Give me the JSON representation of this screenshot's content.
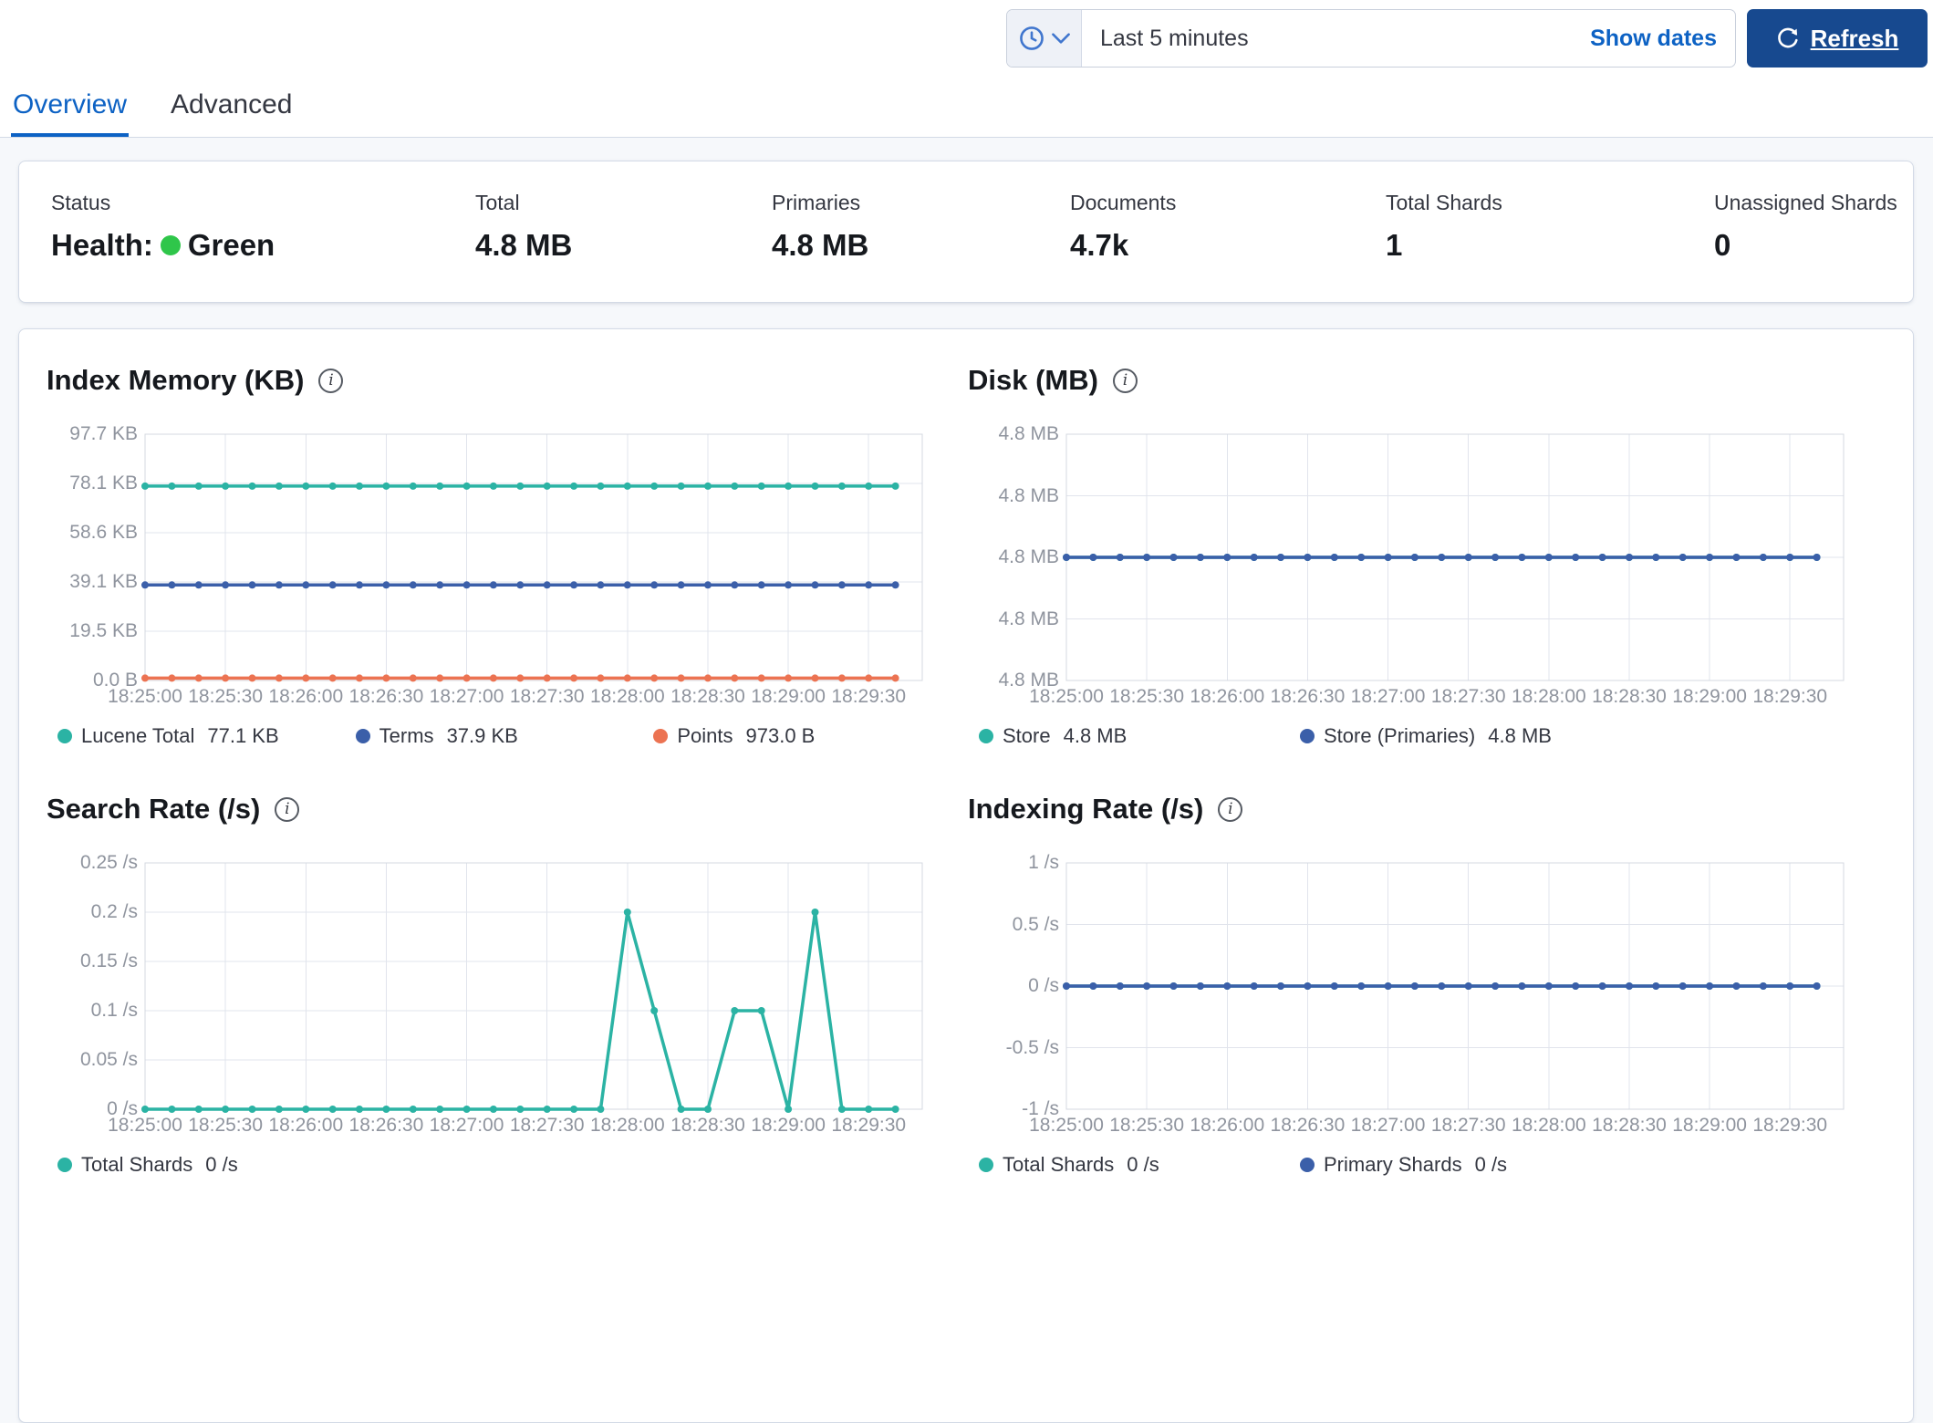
{
  "time_picker": {
    "selected": "Last 5 minutes",
    "show_dates_label": "Show dates",
    "refresh_label": "Refresh"
  },
  "tabs": [
    {
      "label": "Overview",
      "active": true
    },
    {
      "label": "Advanced",
      "active": false
    }
  ],
  "stats": [
    {
      "label": "Status",
      "value_prefix": "Health:",
      "value": "Green"
    },
    {
      "label": "Total",
      "value": "4.8 MB"
    },
    {
      "label": "Primaries",
      "value": "4.8 MB"
    },
    {
      "label": "Documents",
      "value": "4.7k"
    },
    {
      "label": "Total Shards",
      "value": "1"
    },
    {
      "label": "Unassigned Shards",
      "value": "0"
    }
  ],
  "colors": {
    "teal": "#2bb3a4",
    "blue": "#3b5fa9",
    "orange": "#ec7352",
    "health_green": "#2fc64a",
    "link_blue": "#0d62c4",
    "refresh_button_bg": "#17498f"
  },
  "chart_data": [
    {
      "type": "line",
      "title": "Index Memory (KB)",
      "y_ticks": [
        "97.7 KB",
        "78.1 KB",
        "58.6 KB",
        "39.1 KB",
        "19.5 KB",
        "0.0 B"
      ],
      "y_domain": [
        0,
        97.7
      ],
      "x_ticks": [
        "18:25:00",
        "18:25:30",
        "18:26:00",
        "18:26:30",
        "18:27:00",
        "18:27:30",
        "18:28:00",
        "18:28:30",
        "18:29:00",
        "18:29:30"
      ],
      "x_interval_s": 10,
      "x_tick_interval_s": 30,
      "x_span_s": 290,
      "series": [
        {
          "name": "Lucene Total",
          "legend_value": "77.1 KB",
          "color": "#2bb3a4",
          "values": [
            77.1,
            77.1,
            77.1,
            77.1,
            77.1,
            77.1,
            77.1,
            77.1,
            77.1,
            77.1,
            77.1,
            77.1,
            77.1,
            77.1,
            77.1,
            77.1,
            77.1,
            77.1,
            77.1,
            77.1,
            77.1,
            77.1,
            77.1,
            77.1,
            77.1,
            77.1,
            77.1,
            77.1,
            77.1
          ]
        },
        {
          "name": "Terms",
          "legend_value": "37.9 KB",
          "color": "#3b5fa9",
          "values": [
            37.9,
            37.9,
            37.9,
            37.9,
            37.9,
            37.9,
            37.9,
            37.9,
            37.9,
            37.9,
            37.9,
            37.9,
            37.9,
            37.9,
            37.9,
            37.9,
            37.9,
            37.9,
            37.9,
            37.9,
            37.9,
            37.9,
            37.9,
            37.9,
            37.9,
            37.9,
            37.9,
            37.9,
            37.9
          ]
        },
        {
          "name": "Points",
          "legend_value": "973.0 B",
          "color": "#ec7352",
          "values": [
            0.95,
            0.95,
            0.95,
            0.95,
            0.95,
            0.95,
            0.95,
            0.95,
            0.95,
            0.95,
            0.95,
            0.95,
            0.95,
            0.95,
            0.95,
            0.95,
            0.95,
            0.95,
            0.95,
            0.95,
            0.95,
            0.95,
            0.95,
            0.95,
            0.95,
            0.95,
            0.95,
            0.95,
            0.95
          ]
        }
      ]
    },
    {
      "type": "line",
      "title": "Disk (MB)",
      "y_ticks": [
        "4.8 MB",
        "4.8 MB",
        "4.8 MB",
        "4.8 MB",
        "4.8 MB"
      ],
      "y_domain": [
        4.7,
        4.9
      ],
      "x_ticks": [
        "18:25:00",
        "18:25:30",
        "18:26:00",
        "18:26:30",
        "18:27:00",
        "18:27:30",
        "18:28:00",
        "18:28:30",
        "18:29:00",
        "18:29:30"
      ],
      "x_interval_s": 10,
      "x_tick_interval_s": 30,
      "x_span_s": 290,
      "series": [
        {
          "name": "Store",
          "legend_value": "4.8 MB",
          "color": "#2bb3a4",
          "values": [
            4.8,
            4.8,
            4.8,
            4.8,
            4.8,
            4.8,
            4.8,
            4.8,
            4.8,
            4.8,
            4.8,
            4.8,
            4.8,
            4.8,
            4.8,
            4.8,
            4.8,
            4.8,
            4.8,
            4.8,
            4.8,
            4.8,
            4.8,
            4.8,
            4.8,
            4.8,
            4.8,
            4.8,
            4.8
          ]
        },
        {
          "name": "Store (Primaries)",
          "legend_value": "4.8 MB",
          "color": "#3b5fa9",
          "values": [
            4.8,
            4.8,
            4.8,
            4.8,
            4.8,
            4.8,
            4.8,
            4.8,
            4.8,
            4.8,
            4.8,
            4.8,
            4.8,
            4.8,
            4.8,
            4.8,
            4.8,
            4.8,
            4.8,
            4.8,
            4.8,
            4.8,
            4.8,
            4.8,
            4.8,
            4.8,
            4.8,
            4.8,
            4.8
          ]
        }
      ]
    },
    {
      "type": "line",
      "title": "Search Rate (/s)",
      "y_ticks": [
        "0.25 /s",
        "0.2 /s",
        "0.15 /s",
        "0.1 /s",
        "0.05 /s",
        "0 /s"
      ],
      "y_domain": [
        0,
        0.25
      ],
      "x_ticks": [
        "18:25:00",
        "18:25:30",
        "18:26:00",
        "18:26:30",
        "18:27:00",
        "18:27:30",
        "18:28:00",
        "18:28:30",
        "18:29:00",
        "18:29:30"
      ],
      "x_interval_s": 10,
      "x_tick_interval_s": 30,
      "x_span_s": 290,
      "series": [
        {
          "name": "Total Shards",
          "legend_value": "0 /s",
          "color": "#2bb3a4",
          "values": [
            0,
            0,
            0,
            0,
            0,
            0,
            0,
            0,
            0,
            0,
            0,
            0,
            0,
            0,
            0,
            0,
            0,
            0,
            0.2,
            0.1,
            0,
            0,
            0.1,
            0.1,
            0,
            0.2,
            0,
            0,
            0
          ]
        }
      ]
    },
    {
      "type": "line",
      "title": "Indexing Rate (/s)",
      "y_ticks": [
        "1 /s",
        "0.5 /s",
        "0 /s",
        "-0.5 /s",
        "-1 /s"
      ],
      "y_domain": [
        -1,
        1
      ],
      "x_ticks": [
        "18:25:00",
        "18:25:30",
        "18:26:00",
        "18:26:30",
        "18:27:00",
        "18:27:30",
        "18:28:00",
        "18:28:30",
        "18:29:00",
        "18:29:30"
      ],
      "x_interval_s": 10,
      "x_tick_interval_s": 30,
      "x_span_s": 290,
      "series": [
        {
          "name": "Total Shards",
          "legend_value": "0 /s",
          "color": "#2bb3a4",
          "values": [
            0,
            0,
            0,
            0,
            0,
            0,
            0,
            0,
            0,
            0,
            0,
            0,
            0,
            0,
            0,
            0,
            0,
            0,
            0,
            0,
            0,
            0,
            0,
            0,
            0,
            0,
            0,
            0,
            0
          ]
        },
        {
          "name": "Primary Shards",
          "legend_value": "0 /s",
          "color": "#3b5fa9",
          "values": [
            0,
            0,
            0,
            0,
            0,
            0,
            0,
            0,
            0,
            0,
            0,
            0,
            0,
            0,
            0,
            0,
            0,
            0,
            0,
            0,
            0,
            0,
            0,
            0,
            0,
            0,
            0,
            0,
            0
          ]
        }
      ]
    }
  ]
}
